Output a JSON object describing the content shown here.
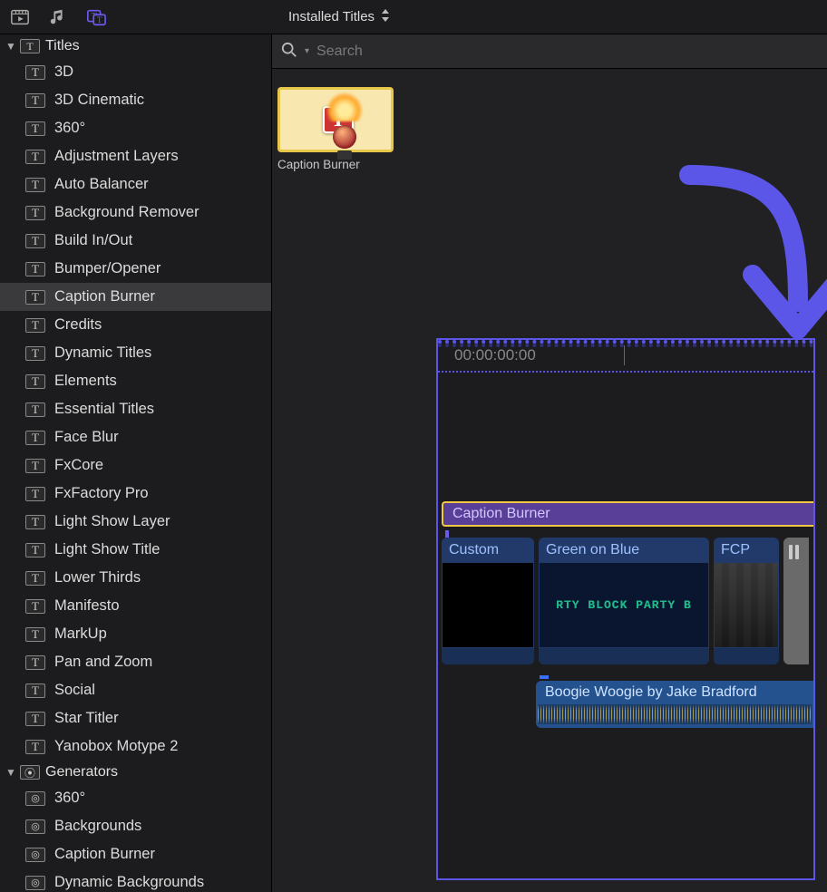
{
  "toolbar": {
    "dropdown_label": "Installed Titles"
  },
  "search": {
    "placeholder": "Search"
  },
  "sidebar": {
    "titles_label": "Titles",
    "generators_label": "Generators",
    "titles_items": [
      "3D",
      "3D Cinematic",
      "360°",
      "Adjustment Layers",
      "Auto Balancer",
      "Background Remover",
      "Build In/Out",
      "Bumper/Opener",
      "Caption Burner",
      "Credits",
      "Dynamic Titles",
      "Elements",
      "Essential Titles",
      "Face Blur",
      "FxCore",
      "FxFactory Pro",
      "Light Show Layer",
      "Light Show Title",
      "Lower Thirds",
      "Manifesto",
      "MarkUp",
      "Pan and Zoom",
      "Social",
      "Star Titler",
      "Yanobox Motype 2"
    ],
    "titles_selected_index": 8,
    "generator_items": [
      "360°",
      "Backgrounds",
      "Caption Burner",
      "Dynamic Backgrounds"
    ]
  },
  "browser": {
    "thumb_label": "Caption Burner"
  },
  "timeline": {
    "timecode": "00:00:00:00",
    "title_clip": "Caption Burner",
    "clips": [
      {
        "label": "Custom"
      },
      {
        "label": "Green on Blue",
        "body_text": "RTY   BLOCK PARTY   B"
      },
      {
        "label": "FCP"
      },
      {
        "label": ""
      }
    ],
    "audio_label": "Boogie Woogie by Jake Bradford"
  }
}
